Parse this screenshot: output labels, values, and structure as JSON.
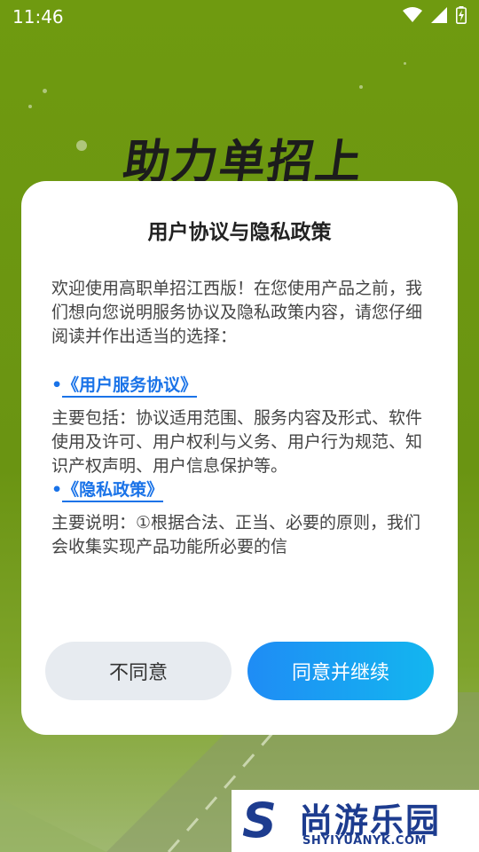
{
  "status_bar": {
    "time": "11:46"
  },
  "background": {
    "slogan": "助力单招上岸"
  },
  "dialog": {
    "title": "用户协议与隐私政策",
    "intro": "欢迎使用高职单招江西版！在您使用产品之前，我们想向您说明服务协议及隐私政策内容，请您仔细阅读并作出适当的选择：",
    "bullet": "•",
    "service_link": "《用户服务协议》",
    "service_summary": "主要包括：协议适用范围、服务内容及形式、软件使用及许可、用户权利与义务、用户行为规范、知识产权声明、用户信息保护等。",
    "privacy_link": "《隐私政策》",
    "privacy_summary": "主要说明：①根据合法、正当、必要的原则，我们会收集实现产品功能所必要的信",
    "decline_label": "不同意",
    "accept_label": "同意并继续"
  },
  "watermark": {
    "mark": "S",
    "name": "尚游乐园",
    "domain": "SHYIYUANYK.COM"
  },
  "colors": {
    "background": "#6f9a10",
    "link": "#1a73e8",
    "accept_start": "#1f8cf5",
    "accept_end": "#13b6ef",
    "decline_bg": "#e7ebf0",
    "watermark": "#1d3c8f"
  }
}
